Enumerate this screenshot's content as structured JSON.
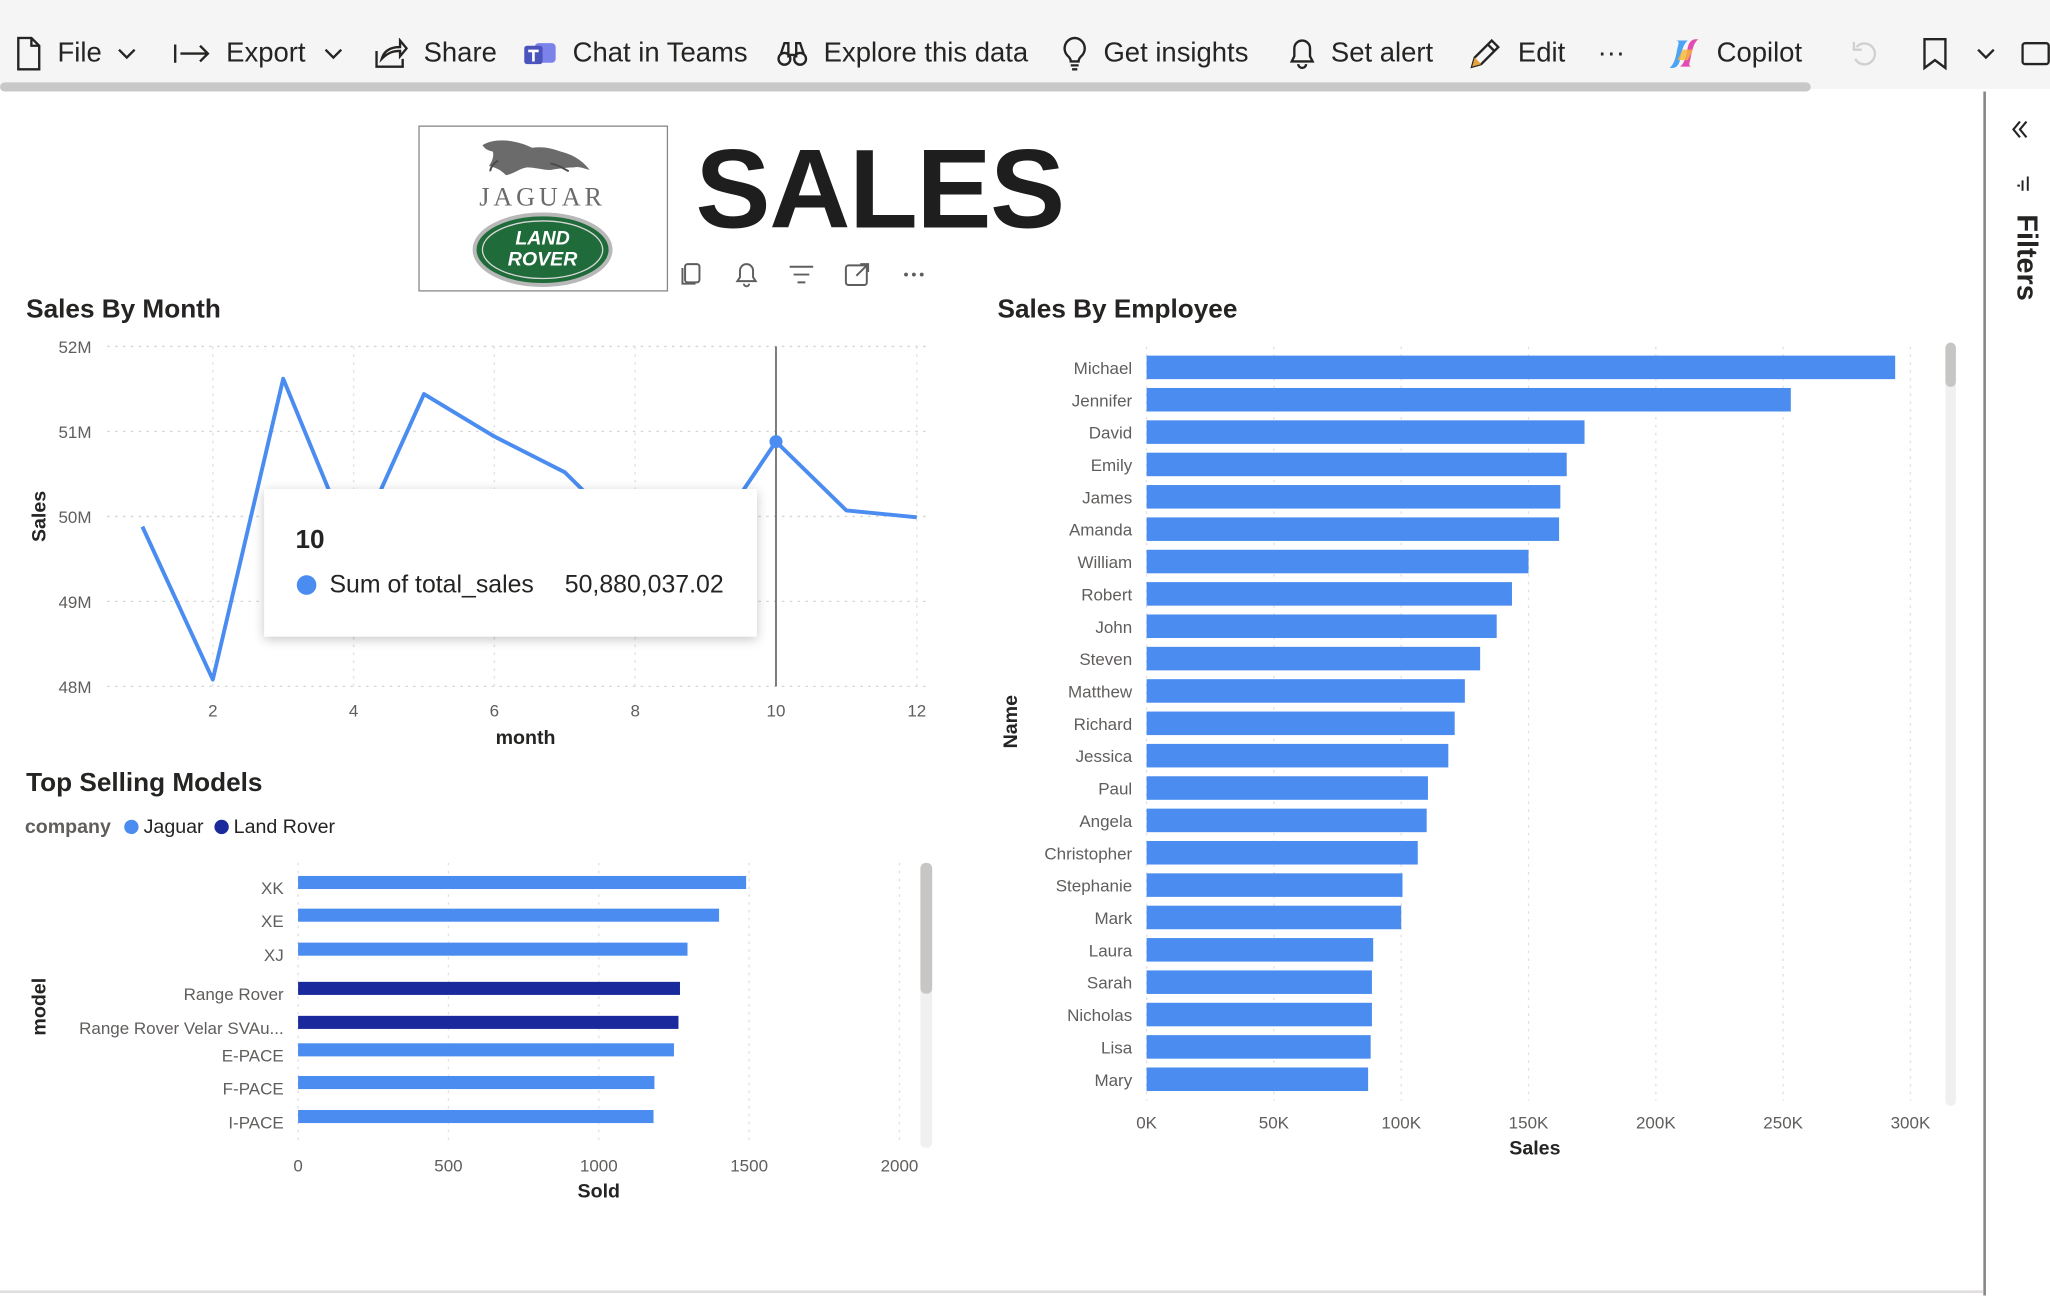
{
  "toolbar": {
    "items": [
      {
        "label": "File",
        "icon": "document-icon"
      },
      {
        "label": "Export",
        "icon": "export-arrow-icon"
      },
      {
        "label": "Share",
        "icon": "share-icon"
      },
      {
        "label": "Chat in Teams",
        "icon": "teams-icon"
      },
      {
        "label": "Explore this data",
        "icon": "binoculars-icon"
      },
      {
        "label": "Get insights",
        "icon": "lightbulb-icon"
      },
      {
        "label": "Set alert",
        "icon": "bell-icon"
      },
      {
        "label": "Edit",
        "icon": "pencil-icon"
      },
      {
        "label": "···",
        "icon": "more-icon"
      },
      {
        "label": "Copilot",
        "icon": "copilot-icon"
      }
    ]
  },
  "filters_pane": {
    "label": "Filters"
  },
  "report": {
    "title": "SALES",
    "logo": {
      "line1": "JAGUAR",
      "line2": "LAND",
      "line3": "ROVER"
    }
  },
  "tooltip": {
    "header": "10",
    "label": "Sum of total_sales",
    "value": "50,880,037.02"
  },
  "legend": {
    "title": "company",
    "items": [
      {
        "name": "Jaguar",
        "color": "#4a8cf0"
      },
      {
        "name": "Land Rover",
        "color": "#1a2a9c"
      }
    ]
  },
  "colors": {
    "primary": "#4a8cf0",
    "secondary": "#1a2a9c",
    "accent_green": "#1f6b3a"
  },
  "chart_data": [
    {
      "type": "line",
      "title": "Sales By Month",
      "xlabel": "month",
      "ylabel": "Sales",
      "x": [
        1,
        2,
        3,
        4,
        5,
        6,
        7,
        8,
        9,
        10,
        11,
        12
      ],
      "values": [
        49.88,
        48.08,
        51.62,
        49.6,
        51.44,
        50.94,
        50.52,
        49.7,
        49.65,
        50.88,
        50.07,
        49.99
      ],
      "y_unit": "M",
      "ylim": [
        48,
        52
      ],
      "y_ticks": [
        "48M",
        "49M",
        "50M",
        "51M",
        "52M"
      ],
      "x_ticks": [
        "2",
        "4",
        "6",
        "8",
        "10",
        "12"
      ],
      "xlim": [
        0.5,
        12.2
      ],
      "highlight_x": 10,
      "grid": true
    },
    {
      "type": "bar",
      "orientation": "horizontal",
      "title": "Top Selling Models",
      "xlabel": "Sold",
      "ylabel": "model",
      "categories": [
        "XK",
        "XE",
        "XJ",
        "Range Rover",
        "Range Rover Velar SVAu...",
        "E-PACE",
        "F-PACE",
        "I-PACE"
      ],
      "values": [
        1490,
        1400,
        1295,
        1270,
        1265,
        1250,
        1185,
        1182
      ],
      "company": [
        "Jaguar",
        "Jaguar",
        "Jaguar",
        "Land Rover",
        "Land Rover",
        "Jaguar",
        "Jaguar",
        "Jaguar"
      ],
      "xlim": [
        0,
        2000
      ],
      "x_ticks": [
        "0",
        "500",
        "1000",
        "1500",
        "2000"
      ],
      "grid": true
    },
    {
      "type": "bar",
      "orientation": "horizontal",
      "title": "Sales By Employee",
      "xlabel": "Sales",
      "ylabel": "Name",
      "categories": [
        "Michael",
        "Jennifer",
        "David",
        "Emily",
        "James",
        "Amanda",
        "William",
        "Robert",
        "John",
        "Steven",
        "Matthew",
        "Richard",
        "Jessica",
        "Paul",
        "Angela",
        "Christopher",
        "Stephanie",
        "Mark",
        "Laura",
        "Sarah",
        "Nicholas",
        "Lisa",
        "Mary"
      ],
      "values": [
        294000,
        253000,
        172000,
        165000,
        162500,
        162000,
        150000,
        143500,
        137500,
        131000,
        125000,
        121000,
        118500,
        110500,
        110000,
        106500,
        100500,
        100000,
        89000,
        88500,
        88500,
        88000,
        87000
      ],
      "xlim": [
        0,
        305000
      ],
      "x_ticks": [
        "0K",
        "50K",
        "100K",
        "150K",
        "200K",
        "250K",
        "300K"
      ],
      "grid": true
    }
  ]
}
